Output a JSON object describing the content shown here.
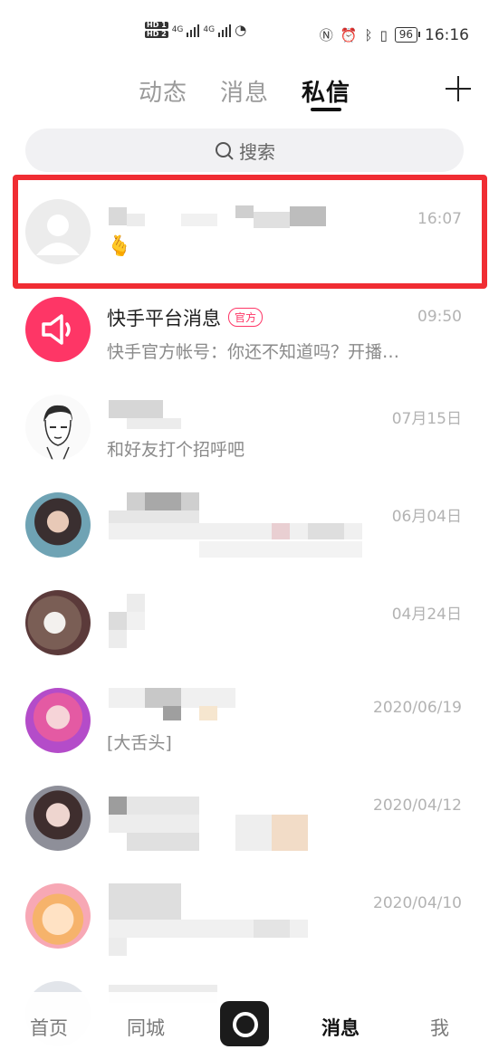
{
  "status_bar": {
    "hd1": "HD 1",
    "hd2": "HD 2",
    "net1": "4G",
    "net2": "4G",
    "battery": "96",
    "time": "16:16"
  },
  "tabs": [
    {
      "label": "动态"
    },
    {
      "label": "消息"
    },
    {
      "label": "私信"
    }
  ],
  "search": {
    "placeholder": "搜索"
  },
  "conversations": [
    {
      "time": "16:07",
      "message": "🫰"
    },
    {
      "name": "快手平台消息",
      "badge": "官方",
      "time": "09:50",
      "message": "快手官方帐号：你还不知道吗？开播…"
    },
    {
      "time": "07月15日",
      "message": "和好友打个招呼吧"
    },
    {
      "time": "06月04日"
    },
    {
      "time": "04月24日"
    },
    {
      "time": "2020/06/19",
      "message": "[大舌头]"
    },
    {
      "time": "2020/04/12"
    },
    {
      "time": "2020/04/10"
    }
  ],
  "bottom_nav": [
    {
      "label": "首页"
    },
    {
      "label": "同城"
    },
    {
      "label": "消息"
    },
    {
      "label": "我"
    }
  ],
  "colors": {
    "accent": "#fe3666",
    "highlight": "#f02d33"
  }
}
